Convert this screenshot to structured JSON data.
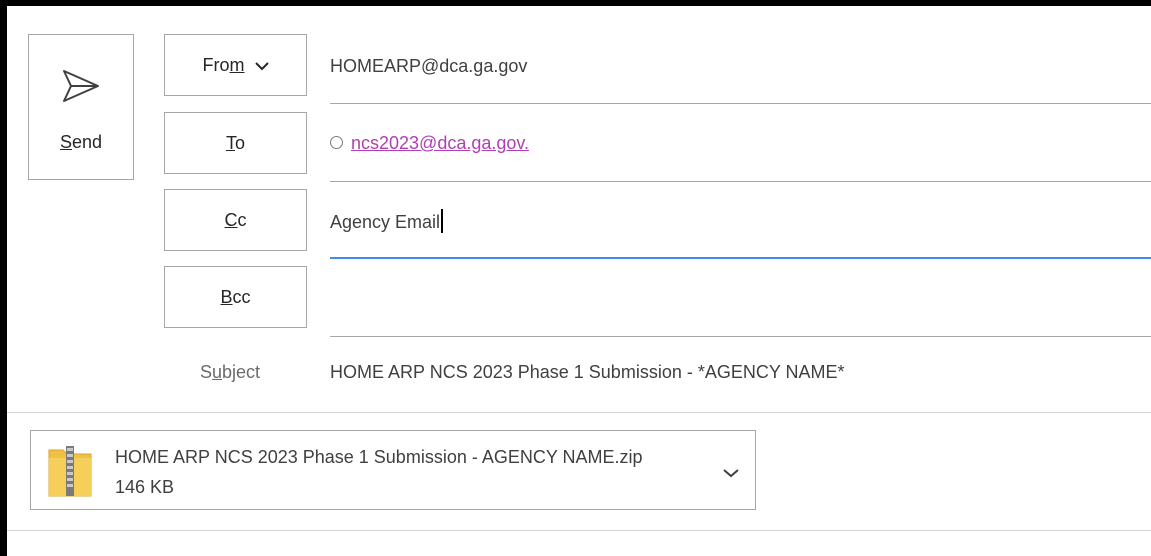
{
  "send": {
    "label": "Send",
    "mnemonic": "S",
    "rest": "end"
  },
  "from": {
    "label_pre": "Fro",
    "label_mnemonic": "m",
    "value": "HOMEARP@dca.ga.gov"
  },
  "to": {
    "label_mnemonic": "T",
    "label_rest": "o",
    "recipient": "ncs2023@dca.ga.gov."
  },
  "cc": {
    "label_mnemonic": "C",
    "label_rest": "c",
    "value": "Agency Email"
  },
  "bcc": {
    "label_mnemonic": "B",
    "label_rest": "cc",
    "value": ""
  },
  "subject": {
    "label_pre": "S",
    "label_mnemonic": "u",
    "label_rest": "bject",
    "value": "HOME ARP NCS 2023 Phase 1 Submission - *AGENCY NAME*"
  },
  "attachment": {
    "name": "HOME ARP NCS 2023 Phase 1 Submission - AGENCY NAME.zip",
    "size": "146 KB",
    "icon": "zip-folder-icon"
  },
  "colors": {
    "recipient_link": "#b03fb5",
    "active_underline": "#3a8ee6",
    "border": "#a6a6a6"
  }
}
